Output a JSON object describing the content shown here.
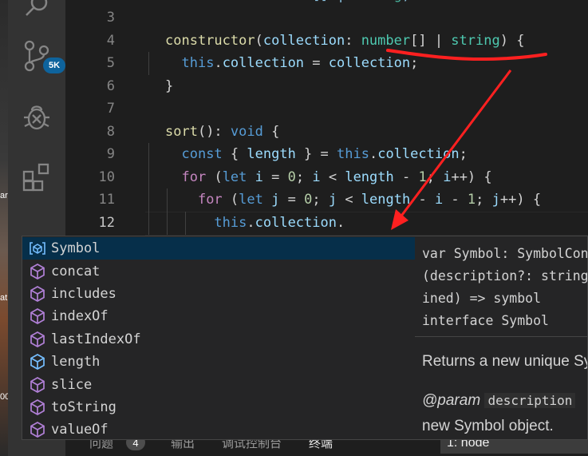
{
  "activity_bar": {
    "scm_badge": "5K",
    "icons": [
      "search-icon",
      "source-control-icon",
      "debug-icon",
      "extensions-icon"
    ]
  },
  "desktop_fragments": [
    "ar",
    "at",
    "00"
  ],
  "editor": {
    "line_numbers": [
      "3",
      "4",
      "5",
      "6",
      "7",
      "8",
      "9",
      "10",
      "11",
      "12"
    ],
    "active_line": "12",
    "lines": [
      {
        "segments": []
      },
      {
        "segments": [
          {
            "t": "constructor",
            "c": "fn"
          },
          {
            "t": "(",
            "c": "punc"
          },
          {
            "t": "collection",
            "c": "var"
          },
          {
            "t": ": ",
            "c": "punc"
          },
          {
            "t": "number",
            "c": "ty"
          },
          {
            "t": "[] | ",
            "c": "punc"
          },
          {
            "t": "string",
            "c": "ty"
          },
          {
            "t": ") {",
            "c": "punc"
          }
        ]
      },
      {
        "segments": [
          {
            "t": "  ",
            "c": "punc"
          },
          {
            "t": "this",
            "c": "kw"
          },
          {
            "t": ".",
            "c": "punc"
          },
          {
            "t": "collection",
            "c": "var"
          },
          {
            "t": " = ",
            "c": "punc"
          },
          {
            "t": "collection",
            "c": "var"
          },
          {
            "t": ";",
            "c": "punc"
          }
        ]
      },
      {
        "segments": [
          {
            "t": "}",
            "c": "punc"
          }
        ]
      },
      {
        "segments": []
      },
      {
        "segments": [
          {
            "t": "sort",
            "c": "fn"
          },
          {
            "t": "(): ",
            "c": "punc"
          },
          {
            "t": "void",
            "c": "kw"
          },
          {
            "t": " {",
            "c": "punc"
          }
        ]
      },
      {
        "segments": [
          {
            "t": "  ",
            "c": "punc"
          },
          {
            "t": "const",
            "c": "kw"
          },
          {
            "t": " { ",
            "c": "punc"
          },
          {
            "t": "length",
            "c": "var"
          },
          {
            "t": " } = ",
            "c": "punc"
          },
          {
            "t": "this",
            "c": "kw"
          },
          {
            "t": ".",
            "c": "punc"
          },
          {
            "t": "collection",
            "c": "var"
          },
          {
            "t": ";",
            "c": "punc"
          }
        ]
      },
      {
        "segments": [
          {
            "t": "  ",
            "c": "punc"
          },
          {
            "t": "for",
            "c": "ctl"
          },
          {
            "t": " (",
            "c": "punc"
          },
          {
            "t": "let",
            "c": "kw"
          },
          {
            "t": " ",
            "c": "punc"
          },
          {
            "t": "i",
            "c": "var"
          },
          {
            "t": " = ",
            "c": "punc"
          },
          {
            "t": "0",
            "c": "num"
          },
          {
            "t": "; ",
            "c": "punc"
          },
          {
            "t": "i",
            "c": "var"
          },
          {
            "t": " < ",
            "c": "punc"
          },
          {
            "t": "length",
            "c": "var"
          },
          {
            "t": " - ",
            "c": "punc"
          },
          {
            "t": "1",
            "c": "num"
          },
          {
            "t": "; ",
            "c": "punc"
          },
          {
            "t": "i",
            "c": "var"
          },
          {
            "t": "++) {",
            "c": "punc"
          }
        ]
      },
      {
        "segments": [
          {
            "t": "    ",
            "c": "punc"
          },
          {
            "t": "for",
            "c": "ctl"
          },
          {
            "t": " (",
            "c": "punc"
          },
          {
            "t": "let",
            "c": "kw"
          },
          {
            "t": " ",
            "c": "punc"
          },
          {
            "t": "j",
            "c": "var"
          },
          {
            "t": " = ",
            "c": "punc"
          },
          {
            "t": "0",
            "c": "num"
          },
          {
            "t": "; ",
            "c": "punc"
          },
          {
            "t": "j",
            "c": "var"
          },
          {
            "t": " < ",
            "c": "punc"
          },
          {
            "t": "length",
            "c": "var"
          },
          {
            "t": " - ",
            "c": "punc"
          },
          {
            "t": "i",
            "c": "var"
          },
          {
            "t": " - ",
            "c": "punc"
          },
          {
            "t": "1",
            "c": "num"
          },
          {
            "t": "; ",
            "c": "punc"
          },
          {
            "t": "j",
            "c": "var"
          },
          {
            "t": "++) {",
            "c": "punc"
          }
        ]
      },
      {
        "segments": [
          {
            "t": "      ",
            "c": "punc"
          },
          {
            "t": "this",
            "c": "kw"
          },
          {
            "t": ".",
            "c": "punc"
          },
          {
            "t": "collection",
            "c": "var"
          },
          {
            "t": ".",
            "c": "punc"
          }
        ]
      }
    ]
  },
  "suggest": {
    "items": [
      {
        "label": "Symbol",
        "kind": "variable",
        "selected": true
      },
      {
        "label": "concat",
        "kind": "method"
      },
      {
        "label": "includes",
        "kind": "method"
      },
      {
        "label": "indexOf",
        "kind": "method"
      },
      {
        "label": "lastIndexOf",
        "kind": "method"
      },
      {
        "label": "length",
        "kind": "field"
      },
      {
        "label": "slice",
        "kind": "method"
      },
      {
        "label": "toString",
        "kind": "method"
      },
      {
        "label": "valueOf",
        "kind": "method"
      }
    ]
  },
  "details": {
    "signature_lines": [
      "var Symbol: SymbolConstructor",
      "(description?: string | number | undef",
      "ined) => symbol",
      "interface Symbol"
    ],
    "description": "Returns a new unique Symbol value.",
    "param_tag": "@param",
    "param_name": "description",
    "param_tail": "new Symbol object."
  },
  "panel": {
    "tabs": [
      "问题",
      "输出",
      "调试控制台",
      "终端"
    ],
    "problems_count": "4",
    "terminal_select": "1: node"
  },
  "colors": {
    "selected_item_bg": "#062f4a",
    "annotation_red": "#ff2020",
    "badge_bg": "#0e639c",
    "method_icon": "#b180d7",
    "field_icon": "#75beff"
  }
}
